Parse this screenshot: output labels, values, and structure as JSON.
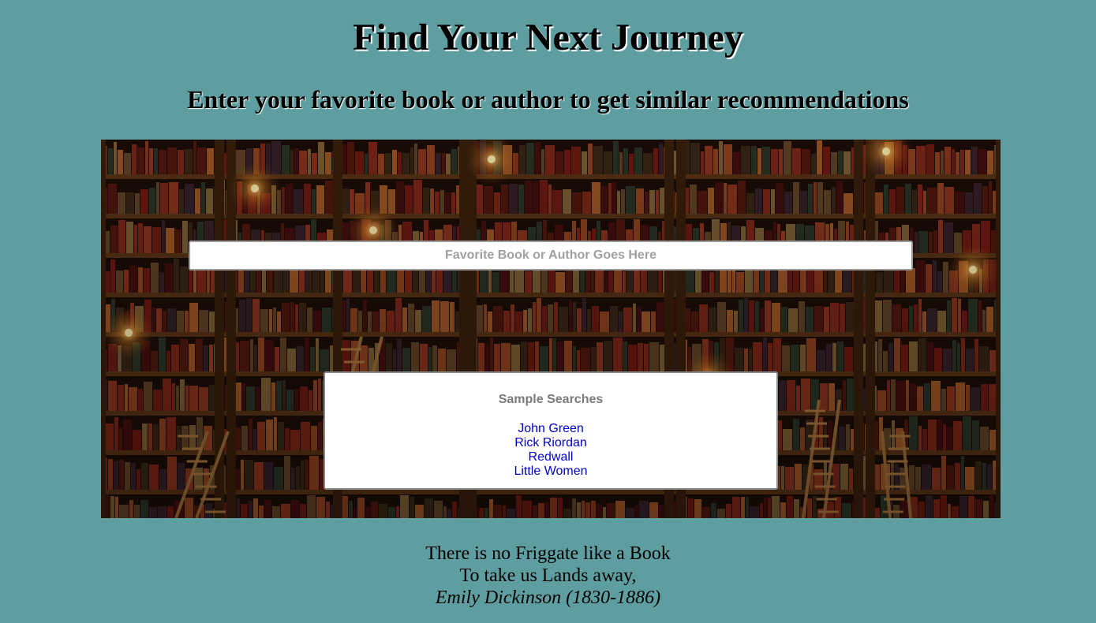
{
  "header": {
    "title": "Find Your Next Journey",
    "subtitle": "Enter your favorite book or author to get similar recommendations"
  },
  "search": {
    "placeholder": "Favorite Book or Author Goes Here",
    "value": ""
  },
  "samples": {
    "heading": "Sample Searches",
    "items": [
      "John Green",
      "Rick Riordan",
      "Redwall",
      "Little Women"
    ]
  },
  "quote": {
    "line1": "There is no Friggate like a Book",
    "line2": "To take us Lands away,",
    "author": "Emily Dickinson (1830-1886)"
  },
  "colors": {
    "background": "#5f9ea0",
    "link": "#0000cc"
  }
}
